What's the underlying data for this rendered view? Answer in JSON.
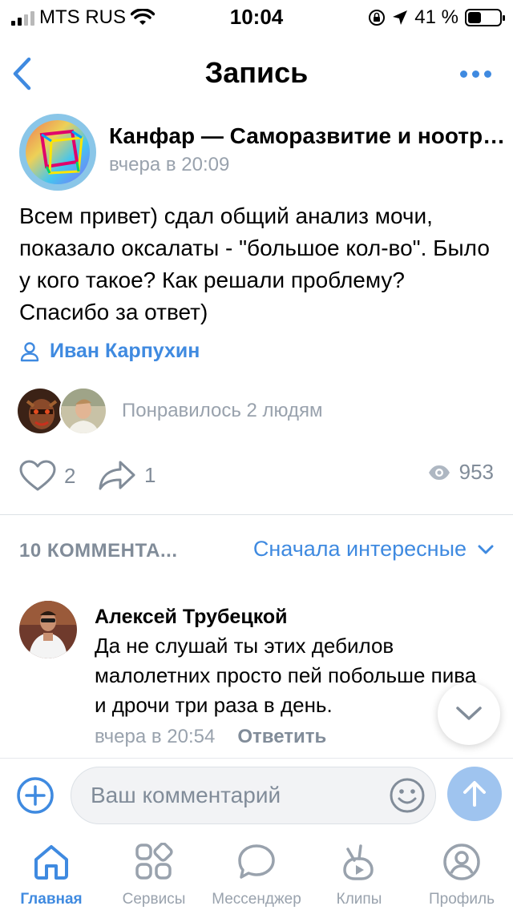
{
  "status_bar": {
    "carrier": "MTS RUS",
    "time": "10:04",
    "battery_percent": "41 %",
    "battery_level": 0.41
  },
  "nav": {
    "title": "Запись",
    "back_icon": "chevron-left-icon",
    "more_icon": "more-horizontal-icon"
  },
  "post": {
    "group_name": "Канфар — Саморазвитие и ноотропы",
    "time": "вчера в 20:09",
    "text": "Всем привет) сдал общий анализ мочи, показало оксалаты - \"большое кол-во\". Было у кого такое? Как решали проблему? Спасибо за ответ)",
    "author": "Иван Карпухин",
    "likers_text": "Понравилось 2 людям",
    "likes": "2",
    "shares": "1",
    "views": "953"
  },
  "comments": {
    "count_label": "10 КОММЕНТА...",
    "sort_label": "Сначала интересные",
    "items": [
      {
        "author": "Алексей Трубецкой",
        "text": "Да не слушай ты этих дебилов малолетних просто пей побольше пива и дрочи три раза в день.",
        "time": "вчера в 20:54",
        "reply_label": "Ответить"
      }
    ]
  },
  "composer": {
    "placeholder": "Ваш комментарий"
  },
  "tabs": [
    {
      "label": "Главная",
      "icon": "home-icon",
      "active": true
    },
    {
      "label": "Сервисы",
      "icon": "services-icon",
      "active": false
    },
    {
      "label": "Мессенджер",
      "icon": "chat-bubble-icon",
      "active": false
    },
    {
      "label": "Клипы",
      "icon": "clips-icon",
      "active": false
    },
    {
      "label": "Профиль",
      "icon": "profile-icon",
      "active": false
    }
  ],
  "colors": {
    "accent": "#3f8ae0",
    "secondary_text": "#99a2ad",
    "send_button": "#9fc4ef"
  }
}
